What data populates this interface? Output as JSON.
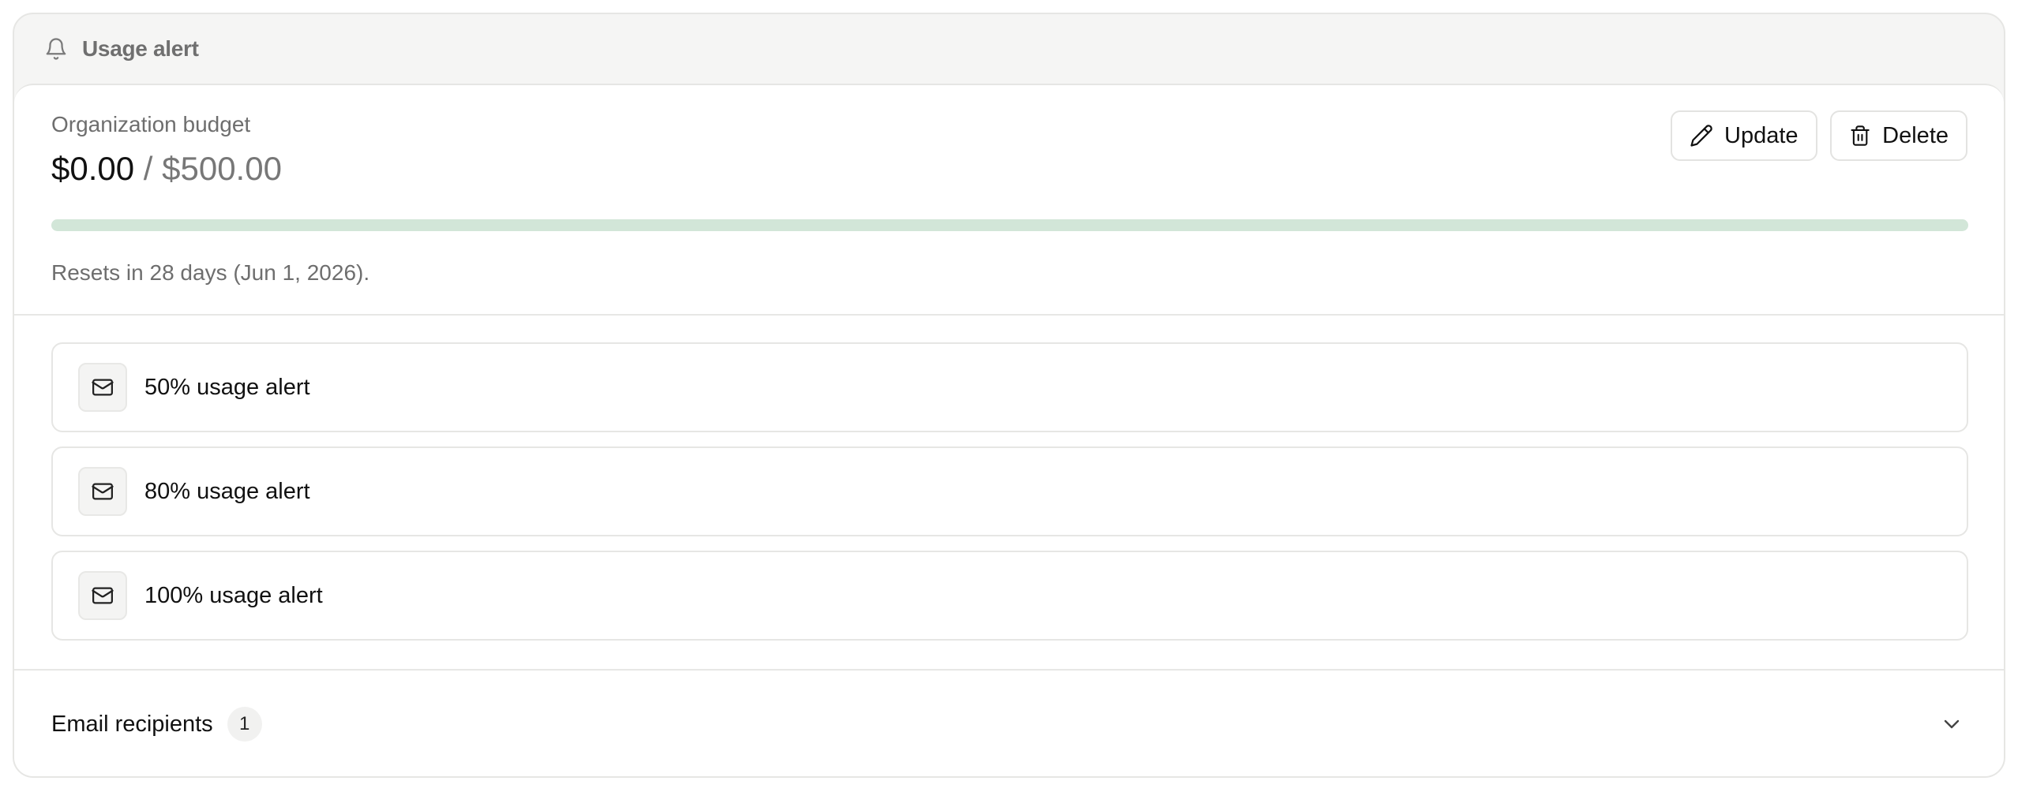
{
  "header": {
    "title": "Usage alert",
    "icon": "bell-icon"
  },
  "budget": {
    "label": "Organization budget",
    "spent": "$0.00",
    "separator": "/",
    "limit": "$500.00",
    "progress_fraction": 0.0,
    "reset_text": "Resets in 28 days (Jun 1, 2026).",
    "track_color": "#d2e6d8"
  },
  "actions": {
    "update_label": "Update",
    "update_icon": "pencil-icon",
    "delete_label": "Delete",
    "delete_icon": "trash-icon"
  },
  "alerts": [
    {
      "label": "50% usage alert",
      "icon": "mail-icon"
    },
    {
      "label": "80% usage alert",
      "icon": "mail-icon"
    },
    {
      "label": "100% usage alert",
      "icon": "mail-icon"
    }
  ],
  "recipients": {
    "label": "Email recipients",
    "count": "1",
    "icon": "chevron-down-icon"
  }
}
